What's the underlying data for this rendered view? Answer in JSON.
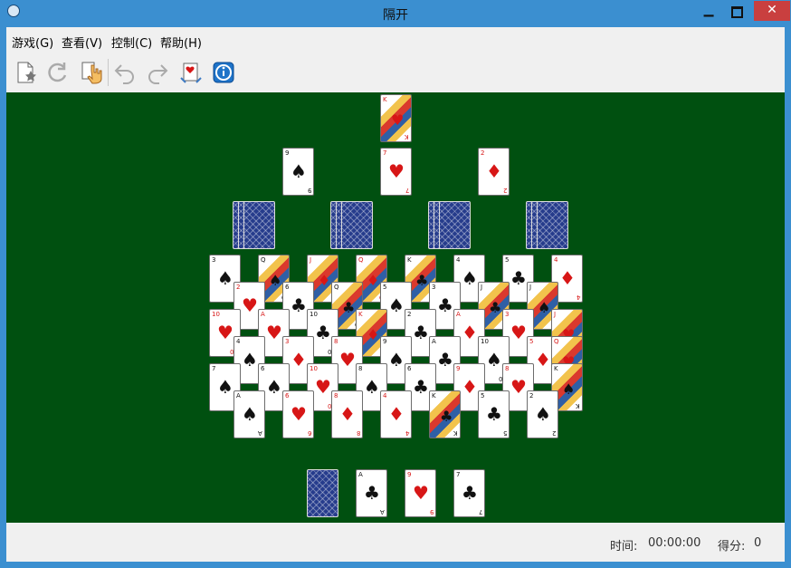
{
  "window": {
    "title": "隔开"
  },
  "menu": {
    "game": "游戏(G)",
    "view": "查看(V)",
    "control": "控制(C)",
    "help": "帮助(H)"
  },
  "toolbar": {
    "new": "new-game",
    "restart": "restart",
    "hint": "hint",
    "undo": "undo",
    "redo": "redo",
    "deal": "deal",
    "info": "info"
  },
  "status": {
    "time_label": "时间:",
    "time_value": "00:00:00",
    "score_label": "得分:",
    "score_value": "0"
  },
  "colors": {
    "board": "#005010",
    "titlebar": "#3b8fd0",
    "red": "#d71616",
    "black": "#111111",
    "card_back": "#263c8c"
  },
  "cards": [
    {
      "rank": "K",
      "suit": "♥",
      "color": "red",
      "face": true
    },
    {
      "rank": "9",
      "suit": "♠",
      "color": "black"
    },
    {
      "rank": "7",
      "suit": "♥",
      "color": "red"
    },
    {
      "rank": "2",
      "suit": "♦",
      "color": "red"
    },
    {
      "rank": "3",
      "suit": "♠",
      "color": "black"
    },
    {
      "rank": "Q",
      "suit": "♠",
      "color": "black",
      "face": true
    },
    {
      "rank": "J",
      "suit": "♦",
      "color": "red",
      "face": true
    },
    {
      "rank": "Q",
      "suit": "♦",
      "color": "red",
      "face": true
    },
    {
      "rank": "K",
      "suit": "♣",
      "color": "black",
      "face": true
    },
    {
      "rank": "4",
      "suit": "♠",
      "color": "black"
    },
    {
      "rank": "5",
      "suit": "♣",
      "color": "black"
    },
    {
      "rank": "4",
      "suit": "♦",
      "color": "red"
    },
    {
      "rank": "2",
      "suit": "♥",
      "color": "red"
    },
    {
      "rank": "6",
      "suit": "♣",
      "color": "black"
    },
    {
      "rank": "Q",
      "suit": "♣",
      "color": "black",
      "face": true
    },
    {
      "rank": "5",
      "suit": "♠",
      "color": "black"
    },
    {
      "rank": "3",
      "suit": "♣",
      "color": "black"
    },
    {
      "rank": "J",
      "suit": "♣",
      "color": "black",
      "face": true
    },
    {
      "rank": "J",
      "suit": "♠",
      "color": "black",
      "face": true
    },
    {
      "rank": "10",
      "suit": "♥",
      "color": "red"
    },
    {
      "rank": "A",
      "suit": "♥",
      "color": "red"
    },
    {
      "rank": "10",
      "suit": "♣",
      "color": "black"
    },
    {
      "rank": "K",
      "suit": "♦",
      "color": "red",
      "face": true
    },
    {
      "rank": "2",
      "suit": "♣",
      "color": "black"
    },
    {
      "rank": "A",
      "suit": "♦",
      "color": "red"
    },
    {
      "rank": "3",
      "suit": "♥",
      "color": "red"
    },
    {
      "rank": "J",
      "suit": "♥",
      "color": "red",
      "face": true
    },
    {
      "rank": "4",
      "suit": "♠",
      "color": "black"
    },
    {
      "rank": "3",
      "suit": "♦",
      "color": "red"
    },
    {
      "rank": "8",
      "suit": "♥",
      "color": "red"
    },
    {
      "rank": "9",
      "suit": "♠",
      "color": "black"
    },
    {
      "rank": "A",
      "suit": "♣",
      "color": "black"
    },
    {
      "rank": "10",
      "suit": "♠",
      "color": "black"
    },
    {
      "rank": "5",
      "suit": "♦",
      "color": "red"
    },
    {
      "rank": "Q",
      "suit": "♥",
      "color": "red",
      "face": true
    },
    {
      "rank": "7",
      "suit": "♠",
      "color": "black"
    },
    {
      "rank": "6",
      "suit": "♠",
      "color": "black"
    },
    {
      "rank": "10",
      "suit": "♥",
      "color": "red"
    },
    {
      "rank": "8",
      "suit": "♠",
      "color": "black"
    },
    {
      "rank": "6",
      "suit": "♣",
      "color": "black"
    },
    {
      "rank": "9",
      "suit": "♦",
      "color": "red"
    },
    {
      "rank": "8",
      "suit": "♥",
      "color": "red"
    },
    {
      "rank": "K",
      "suit": "♠",
      "color": "black",
      "face": true
    },
    {
      "rank": "A",
      "suit": "♠",
      "color": "black"
    },
    {
      "rank": "6",
      "suit": "♥",
      "color": "red"
    },
    {
      "rank": "8",
      "suit": "♦",
      "color": "red"
    },
    {
      "rank": "4",
      "suit": "♦",
      "color": "red"
    },
    {
      "rank": "K",
      "suit": "♣",
      "color": "black",
      "face": true
    },
    {
      "rank": "5",
      "suit": "♣",
      "color": "black"
    },
    {
      "rank": "2",
      "suit": "♠",
      "color": "black"
    },
    {
      "rank": "A",
      "suit": "♣",
      "color": "black"
    },
    {
      "rank": "9",
      "suit": "♥",
      "color": "red"
    },
    {
      "rank": "7",
      "suit": "♣",
      "color": "black"
    }
  ]
}
